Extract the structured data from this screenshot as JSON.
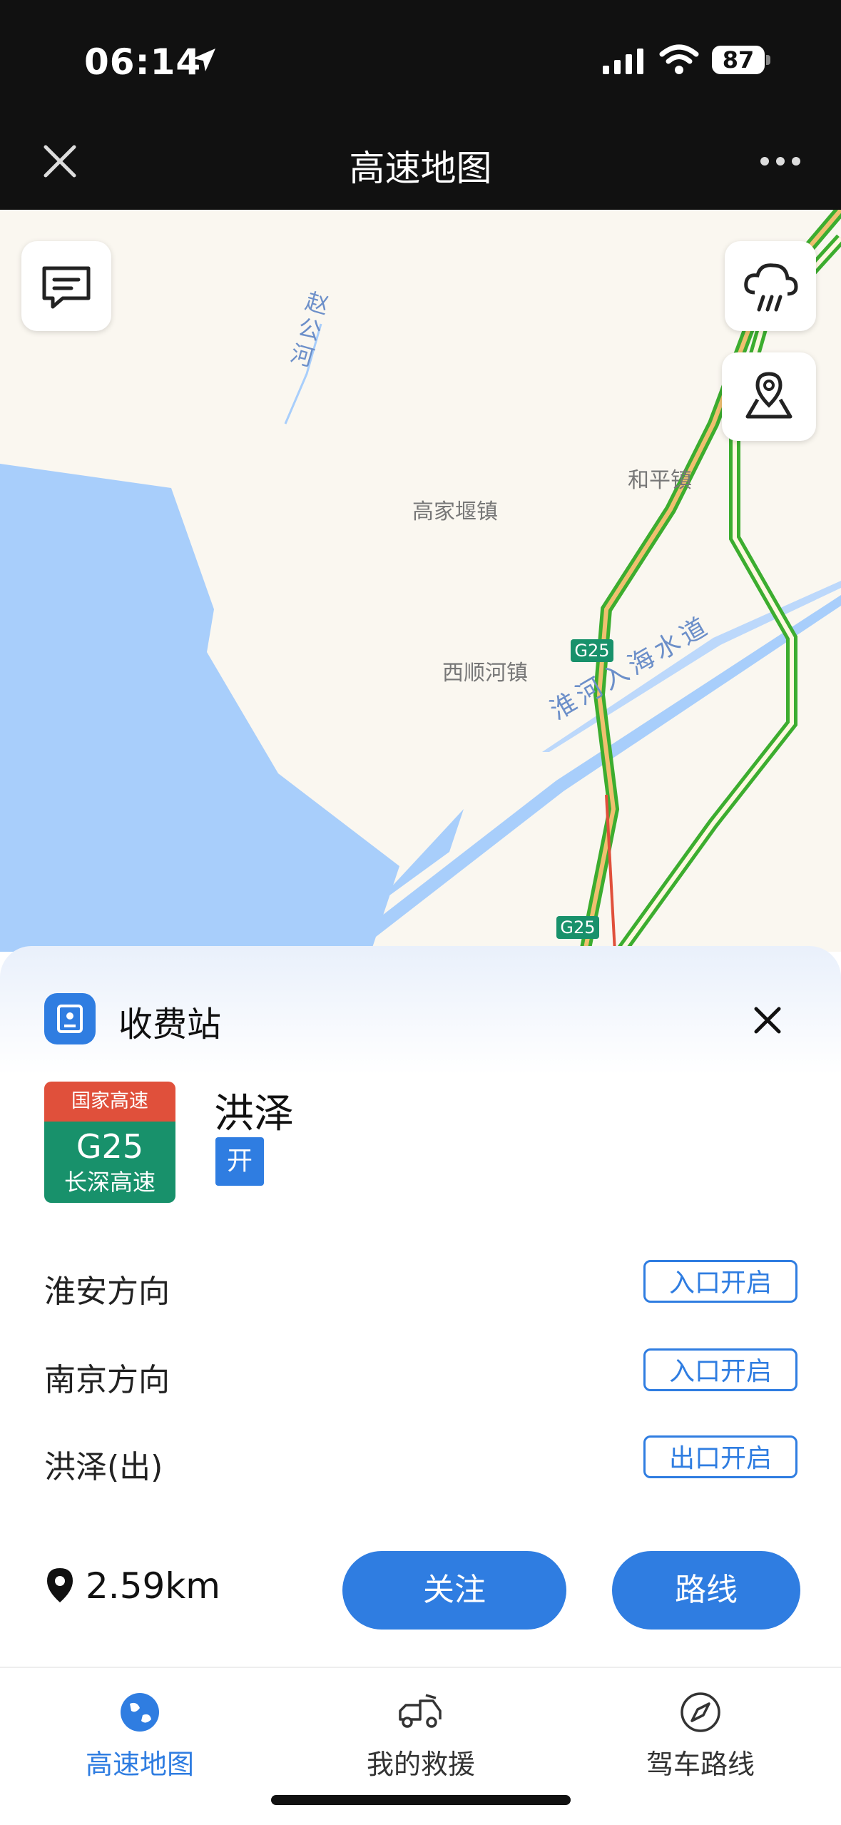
{
  "status_bar": {
    "time": "06:14",
    "battery": "87"
  },
  "header": {
    "title": "高速地图"
  },
  "map": {
    "labels": {
      "river_zhaogong": "赵公河",
      "gaojiayan": "高家堰镇",
      "heping": "和平镇",
      "xishunhe": "西顺河镇",
      "waterway": "淮河入海水道"
    },
    "route_markers": [
      "G25",
      "G25"
    ]
  },
  "sheet": {
    "title": "收费站",
    "shield": {
      "type": "国家高速",
      "code": "G25",
      "name": "长深高速"
    },
    "station_name": "洪泽",
    "station_tag": "开",
    "directions": [
      {
        "label": "淮安方向",
        "status": "入口开启"
      },
      {
        "label": "南京方向",
        "status": "入口开启"
      },
      {
        "label": "洪泽(出)",
        "status": "出口开启"
      }
    ],
    "distance": "2.59km",
    "follow_label": "关注",
    "route_label": "路线"
  },
  "tabs": [
    {
      "label": "高速地图",
      "icon": "globe-icon",
      "active": true
    },
    {
      "label": "我的救援",
      "icon": "tow-truck-icon",
      "active": false
    },
    {
      "label": "驾车路线",
      "icon": "compass-icon",
      "active": false
    }
  ],
  "colors": {
    "accent": "#2f7de1",
    "shield_red": "#e0503b",
    "shield_green": "#18916b",
    "water": "#a8cefb",
    "road_green": "#3cad2f"
  }
}
